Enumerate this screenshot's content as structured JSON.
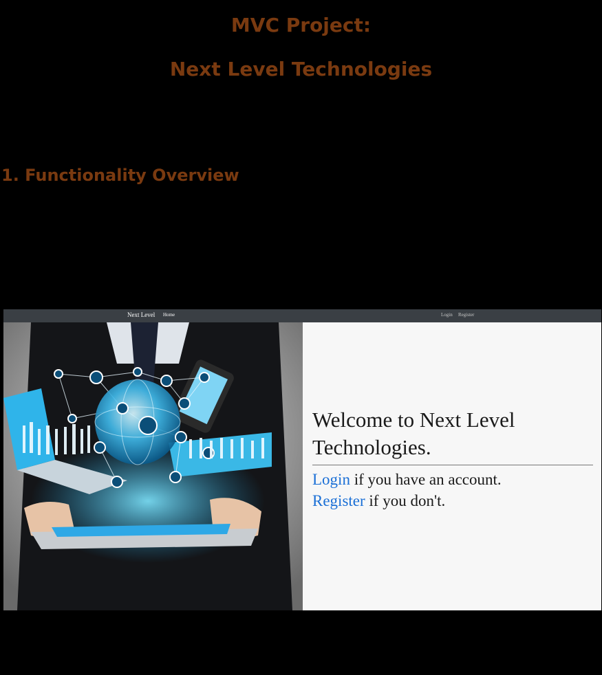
{
  "doc": {
    "title_line1": "MVC Project:",
    "title_line2": "Next Level Technologies",
    "section_heading": "1. Functionality Overview"
  },
  "app": {
    "navbar": {
      "brand": "Next Level",
      "home": "Home",
      "login": "Login",
      "register": "Register"
    },
    "welcome": {
      "heading": "Welcome to Next Level Technologies.",
      "login_link": "Login",
      "login_suffix": " if you have an account.",
      "register_link": "Register",
      "register_suffix": " if you don't."
    }
  },
  "colors": {
    "background": "#000000",
    "heading": "#7a3a10",
    "navbar": "#3a3f44",
    "link": "#1a6fd6"
  }
}
